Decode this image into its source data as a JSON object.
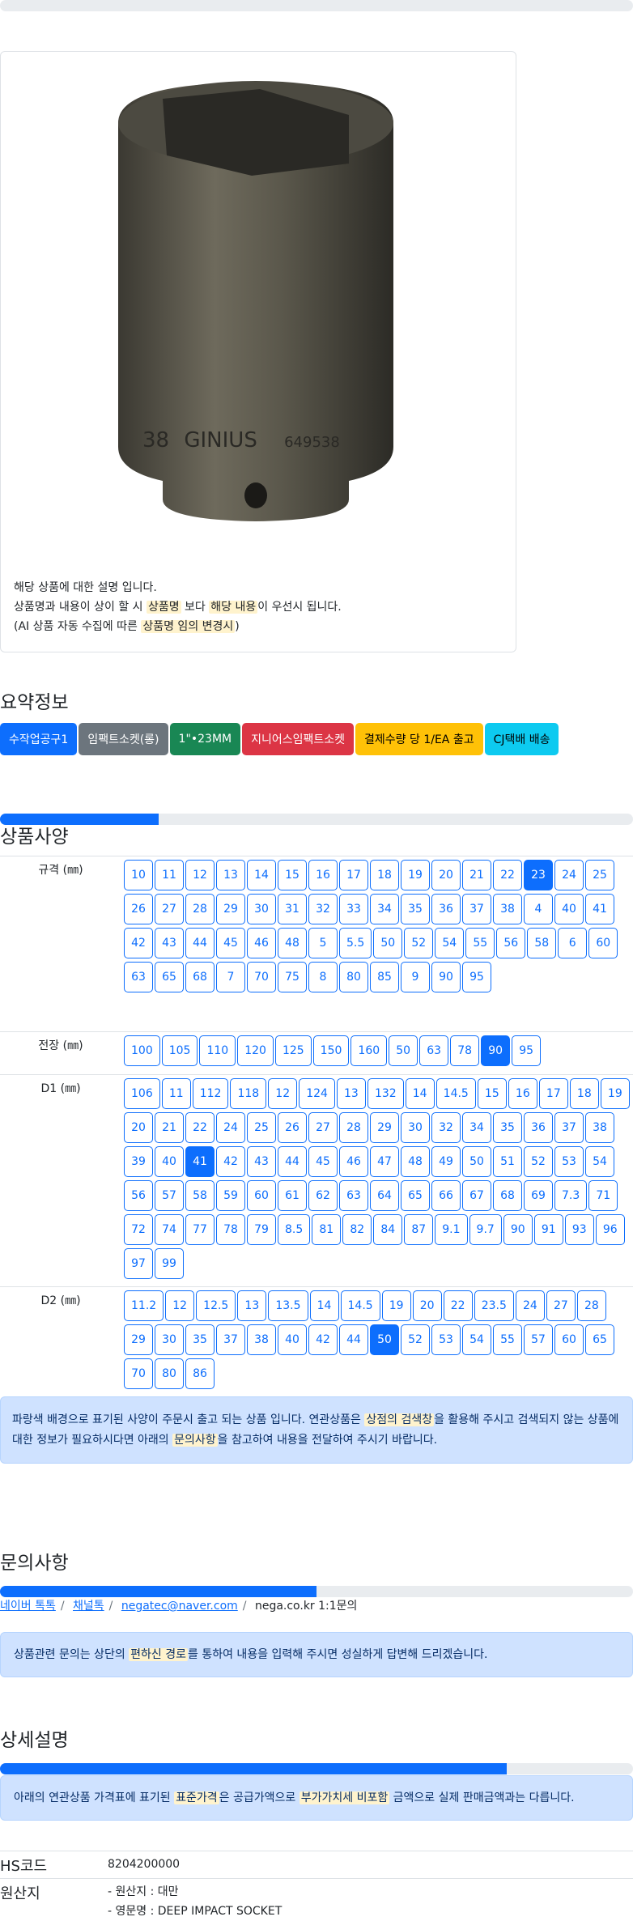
{
  "product": {
    "desc_line1": "해당 상품에 대한 설명 입니다.",
    "desc_line2_a": "상품명과 내용이 상이 할 시 ",
    "desc_line2_hl1": "상품명",
    "desc_line2_b": " 보다 ",
    "desc_line2_hl2": "해당 내용",
    "desc_line2_c": "이 우선시 됩니다.",
    "desc_line3_a": "(AI 상품 자동 수집에 따른 ",
    "desc_line3_hl": "상품명 임의 변경시",
    "desc_line3_b": ")",
    "img_text_left": "38",
    "img_text_brand": "GINIUS",
    "img_text_right": "649538"
  },
  "summary": {
    "title": "요약정보",
    "badges": [
      {
        "label": "수작업공구1",
        "color": "#0d6efd"
      },
      {
        "label": "임팩트소켓(롱)",
        "color": "#6c757d"
      },
      {
        "label": "1\"•23MM",
        "color": "#198754"
      },
      {
        "label": "지니어스임팩트소켓",
        "color": "#dc3545"
      },
      {
        "label": "결제수량 당 1/EA 출고",
        "color": "#ffc107"
      },
      {
        "label": "CJ택배 배송",
        "color": "#0dcaf0"
      }
    ]
  },
  "specs": {
    "title": "상품사양",
    "progress": 0.25,
    "rows": [
      {
        "label": "규격 (㎜)",
        "values": [
          "10",
          "11",
          "12",
          "13",
          "14",
          "15",
          "16",
          "17",
          "18",
          "19",
          "20",
          "21",
          "22",
          "23",
          "24",
          "25",
          "26",
          "27",
          "28",
          "29",
          "30",
          "31",
          "32",
          "33",
          "34",
          "35",
          "36",
          "37",
          "38",
          "4",
          "40",
          "41",
          "42",
          "43",
          "44",
          "45",
          "46",
          "48",
          "5",
          "5.5",
          "50",
          "52",
          "54",
          "55",
          "56",
          "58",
          "6",
          "60",
          "63",
          "65",
          "68",
          "7",
          "70",
          "75",
          "8",
          "80",
          "85",
          "9",
          "90",
          "95"
        ],
        "selected": "23"
      },
      {
        "label": "전장 (㎜)",
        "values": [
          "100",
          "105",
          "110",
          "120",
          "125",
          "150",
          "160",
          "50",
          "63",
          "78",
          "90",
          "95"
        ],
        "selected": "90"
      },
      {
        "label": "D1 (㎜)",
        "values": [
          "106",
          "11",
          "112",
          "118",
          "12",
          "124",
          "13",
          "132",
          "14",
          "14.5",
          "15",
          "16",
          "17",
          "18",
          "19",
          "20",
          "21",
          "22",
          "24",
          "25",
          "26",
          "27",
          "28",
          "29",
          "30",
          "32",
          "34",
          "35",
          "36",
          "37",
          "38",
          "39",
          "40",
          "41",
          "42",
          "43",
          "44",
          "45",
          "46",
          "47",
          "48",
          "49",
          "50",
          "51",
          "52",
          "53",
          "54",
          "56",
          "57",
          "58",
          "59",
          "60",
          "61",
          "62",
          "63",
          "64",
          "65",
          "66",
          "67",
          "68",
          "69",
          "7.3",
          "71",
          "72",
          "74",
          "77",
          "78",
          "79",
          "8.5",
          "81",
          "82",
          "84",
          "87",
          "9.1",
          "9.7",
          "90",
          "91",
          "93",
          "96",
          "97",
          "99"
        ],
        "selected": "41"
      },
      {
        "label": "D2 (㎜)",
        "values": [
          "11.2",
          "12",
          "12.5",
          "13",
          "13.5",
          "14",
          "14.5",
          "19",
          "20",
          "22",
          "23.5",
          "24",
          "27",
          "28",
          "29",
          "30",
          "35",
          "37",
          "38",
          "40",
          "42",
          "44",
          "50",
          "52",
          "53",
          "54",
          "55",
          "57",
          "60",
          "65",
          "70",
          "80",
          "86"
        ],
        "selected": "50"
      }
    ],
    "notice_a": "파랑색 배경으로 표기된 사양이 주문시 출고 되는 상품 입니다. 연관상품은 ",
    "notice_hl1": "상점의 검색창",
    "notice_b": "을 활용해 주시고 검색되지 않는 상품에 대한 정보가 필요하시다면 아래의 ",
    "notice_hl2": "문의사항",
    "notice_c": "을 참고하여 내용을 전달하여 주시기 바랍니다."
  },
  "inquiry": {
    "title": "문의사항",
    "progress": 0.5,
    "links": [
      "네이버 톡톡",
      "채널톡",
      "negatec@naver.com"
    ],
    "last": "nega.co.kr 1:1문의",
    "notice_a": "상품관련 문의는 상단의 ",
    "notice_hl": "편하신 경로",
    "notice_b": "를 통하여 내용을 입력해 주시면 성실하게 답변해 드리겠습니다."
  },
  "detail": {
    "title": "상세설명",
    "progress": 0.8,
    "notice_a": "아래의 연관상품 가격표에 표기된 ",
    "notice_hl1": "표준가격",
    "notice_b": "은 공급가액으로 ",
    "notice_hl2": "부가가치세 비포함",
    "notice_c": " 금액으로 실제 판매금액과는 다릅니다.",
    "hs_key": "HS코드",
    "hs_val": "8204200000",
    "origin_key": "원산지",
    "origin_line1": "- 원산지 : 대만",
    "origin_line2": "- 영문명 : DEEP IMPACT SOCKET"
  }
}
